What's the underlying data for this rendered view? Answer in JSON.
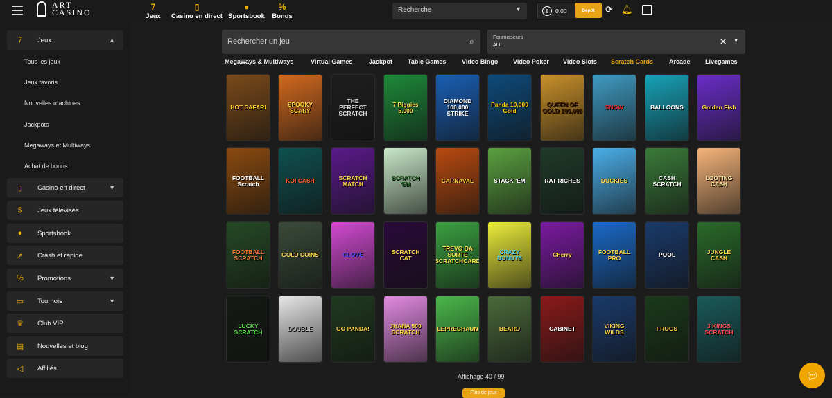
{
  "header": {
    "logo_line1": "ART",
    "logo_line2": "CASINO",
    "nav": [
      {
        "icon": "seven-icon",
        "label": "Jeux"
      },
      {
        "icon": "cards-icon",
        "label": "Casino en direct"
      },
      {
        "icon": "ball-icon",
        "label": "Sportsbook"
      },
      {
        "icon": "percent-icon",
        "label": "Bonus"
      }
    ],
    "search_value": "Recherche",
    "balance": "0.00",
    "deposit_label": "Dépôt"
  },
  "sidebar": {
    "sections": [
      {
        "label": "Jeux",
        "icon": "seven-icon",
        "expanded": true
      },
      {
        "label": "Casino en direct",
        "icon": "cards-icon"
      },
      {
        "label": "Jeux télévisés",
        "icon": "coin-icon"
      },
      {
        "label": "Sportsbook",
        "icon": "ball-icon"
      },
      {
        "label": "Crash et rapide",
        "icon": "rocket-icon"
      },
      {
        "label": "Promotions",
        "icon": "percent-icon"
      },
      {
        "label": "Tournois",
        "icon": "ticket-icon"
      },
      {
        "label": "Club VIP",
        "icon": "crown-icon"
      },
      {
        "label": "Nouvelles et blog",
        "icon": "chat-icon"
      },
      {
        "label": "Affiliés",
        "icon": "megaphone-icon"
      }
    ],
    "sub_items": [
      "Tous les jeux",
      "Jeux favoris",
      "Nouvelles machines",
      "Jackpots",
      "Megaways et Multiways",
      "Achat de bonus"
    ]
  },
  "filters": {
    "search_placeholder": "Rechercher un jeu",
    "providers_label": "Fournisseurs",
    "providers_value": "ALL"
  },
  "categories": [
    "Megaways & Multiways",
    "Virtual Games",
    "Jackpot",
    "Table Games",
    "Video Bingo",
    "Video Poker",
    "Video Slots",
    "Scratch Cards",
    "Arcade",
    "Livegames"
  ],
  "active_category": "Scratch Cards",
  "games": [
    {
      "title": "HOT SAFARI",
      "bg": "#7a4a1a",
      "fg": "#ffcc33"
    },
    {
      "title": "SPOOKY SCARY",
      "bg": "#d2691e",
      "fg": "#ffd23a"
    },
    {
      "title": "THE PERFECT SCRATCH",
      "bg": "#1e1e1e",
      "fg": "#dddddd"
    },
    {
      "title": "7 Piggies 5.000",
      "bg": "#1d8a3a",
      "fg": "#ffd54a"
    },
    {
      "title": "DIAMOND 100,000 STRIKE",
      "bg": "#1a5fb4",
      "fg": "#ffffff"
    },
    {
      "title": "Panda 10,000 Gold",
      "bg": "#0e4a7a",
      "fg": "#ffcc00"
    },
    {
      "title": "QUEEN OF GOLD 100,000",
      "bg": "#c8902a",
      "fg": "#3a1a00"
    },
    {
      "title": "SNOW",
      "bg": "#3f9bc2",
      "fg": "#e02020"
    },
    {
      "title": "BALLOONS",
      "bg": "#17a2b8",
      "fg": "#ffffff"
    },
    {
      "title": "Golden Fish",
      "bg": "#6a2dc8",
      "fg": "#ffd24a"
    },
    {
      "title": "FOOTBALL Scratch",
      "bg": "#8a4a10",
      "fg": "#ffffff"
    },
    {
      "title": "KOI CASH",
      "bg": "#0f5050",
      "fg": "#ff5a2a"
    },
    {
      "title": "SCRATCH MATCH",
      "bg": "#5a1a8a",
      "fg": "#ffd24a"
    },
    {
      "title": "SCRATCH 'EM",
      "bg": "#c8e8c8",
      "fg": "#1a5a1a"
    },
    {
      "title": "CARNAVAL",
      "bg": "#b84a10",
      "fg": "#ffd24a"
    },
    {
      "title": "STACK 'EM",
      "bg": "#5aa040",
      "fg": "#ffffff"
    },
    {
      "title": "RAT RICHES",
      "bg": "#1f3a2a",
      "fg": "#ffffff"
    },
    {
      "title": "DUCKIES",
      "bg": "#4aaee8",
      "fg": "#ffe14a"
    },
    {
      "title": "CASH SCRATCH",
      "bg": "#3a7a3a",
      "fg": "#ffffff"
    },
    {
      "title": "LOOTING CASH",
      "bg": "#f5b47a",
      "fg": "#ffe6a0"
    },
    {
      "title": "FOOTBALL SCRATCH",
      "bg": "#254a25",
      "fg": "#ff7a30"
    },
    {
      "title": "GOLD COINS",
      "bg": "#3a4a3a",
      "fg": "#ffd24a"
    },
    {
      "title": "CLOVE",
      "bg": "#d24ad2",
      "fg": "#4a4aff"
    },
    {
      "title": "SCRATCH CAT",
      "bg": "#2a0a3a",
      "fg": "#ffd24a"
    },
    {
      "title": "TREVO DA SORTE SCRATCHCARD",
      "bg": "#3aa040",
      "fg": "#ffe14a"
    },
    {
      "title": "CRAZY DONUTS",
      "bg": "#ecec3a",
      "fg": "#4ac8e8"
    },
    {
      "title": "Cherry",
      "bg": "#7a1aa0",
      "fg": "#ffd24a"
    },
    {
      "title": "FOOTBALL PRO",
      "bg": "#1a6ac8",
      "fg": "#ffd24a"
    },
    {
      "title": "POOL",
      "bg": "#1a3a6a",
      "fg": "#ffffff"
    },
    {
      "title": "JUNGLE CASH",
      "bg": "#2a6a2a",
      "fg": "#ffd24a"
    },
    {
      "title": "LUCKY SCRATCH",
      "bg": "#151a15",
      "fg": "#5ae04a"
    },
    {
      "title": "DOUBLE",
      "bg": "#e6e6e6",
      "fg": "#bdbdbd"
    },
    {
      "title": "GO PANDA!",
      "bg": "#1f3a1f",
      "fg": "#ffd24a"
    },
    {
      "title": "JHANA 500 SCRATCH",
      "bg": "#e28ae2",
      "fg": "#ffd24a"
    },
    {
      "title": "LEPRECHAUN",
      "bg": "#4ab84a",
      "fg": "#ffd24a"
    },
    {
      "title": "BEARD",
      "bg": "#4a6a3a",
      "fg": "#ffd24a"
    },
    {
      "title": "CABINET",
      "bg": "#8a1a1a",
      "fg": "#ffffff"
    },
    {
      "title": "VIKING WILDS",
      "bg": "#1a3a6a",
      "fg": "#ffd24a"
    },
    {
      "title": "FROGS",
      "bg": "#1a3a1a",
      "fg": "#ffd24a"
    },
    {
      "title": "3 KINGS SCRATCH",
      "bg": "#1a5a5a",
      "fg": "#ff4a4a"
    }
  ],
  "pagination": {
    "text": "Affichage 40 / 99",
    "more_label": "Plus de jeux"
  }
}
